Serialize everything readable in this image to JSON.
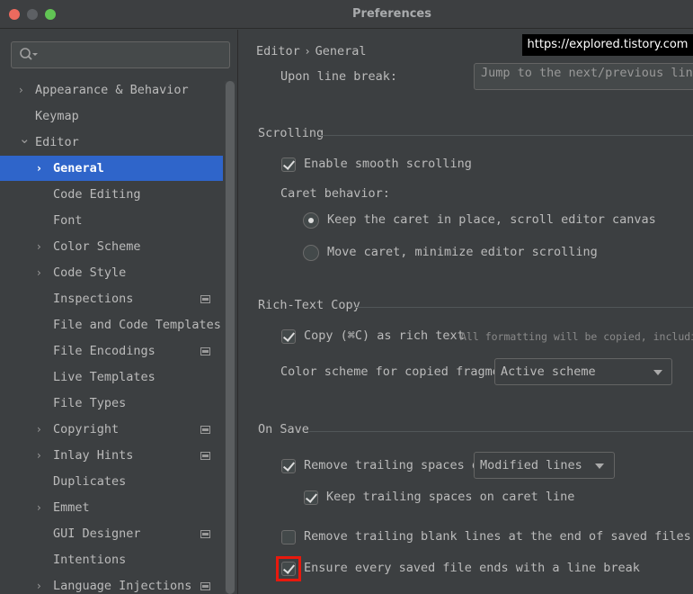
{
  "window": {
    "title": "Preferences"
  },
  "sidebar": {
    "search": {
      "placeholder": ""
    },
    "items": [
      {
        "label": "Appearance & Behavior",
        "expandable": true,
        "expanded": false,
        "level": 0,
        "tag": false
      },
      {
        "label": "Keymap",
        "expandable": false,
        "level": 0,
        "tag": false
      },
      {
        "label": "Editor",
        "expandable": true,
        "expanded": true,
        "level": 0,
        "tag": false
      },
      {
        "label": "General",
        "expandable": true,
        "expanded": false,
        "level": 1,
        "tag": false,
        "selected": true
      },
      {
        "label": "Code Editing",
        "expandable": false,
        "level": 1,
        "tag": false
      },
      {
        "label": "Font",
        "expandable": false,
        "level": 1,
        "tag": false
      },
      {
        "label": "Color Scheme",
        "expandable": true,
        "expanded": false,
        "level": 1,
        "tag": false
      },
      {
        "label": "Code Style",
        "expandable": true,
        "expanded": false,
        "level": 1,
        "tag": false
      },
      {
        "label": "Inspections",
        "expandable": false,
        "level": 1,
        "tag": true
      },
      {
        "label": "File and Code Templates",
        "expandable": false,
        "level": 1,
        "tag": false
      },
      {
        "label": "File Encodings",
        "expandable": false,
        "level": 1,
        "tag": true
      },
      {
        "label": "Live Templates",
        "expandable": false,
        "level": 1,
        "tag": false
      },
      {
        "label": "File Types",
        "expandable": false,
        "level": 1,
        "tag": false
      },
      {
        "label": "Copyright",
        "expandable": true,
        "expanded": false,
        "level": 1,
        "tag": true
      },
      {
        "label": "Inlay Hints",
        "expandable": true,
        "expanded": false,
        "level": 1,
        "tag": true
      },
      {
        "label": "Duplicates",
        "expandable": false,
        "level": 1,
        "tag": false
      },
      {
        "label": "Emmet",
        "expandable": true,
        "expanded": false,
        "level": 1,
        "tag": false
      },
      {
        "label": "GUI Designer",
        "expandable": false,
        "level": 1,
        "tag": true
      },
      {
        "label": "Intentions",
        "expandable": false,
        "level": 1,
        "tag": false
      },
      {
        "label": "Language Injections",
        "expandable": true,
        "expanded": false,
        "level": 1,
        "tag": true
      }
    ]
  },
  "breadcrumb": {
    "parent": "Editor",
    "separator": "›",
    "current": "General"
  },
  "watermark": "https://explored.tistory.com",
  "content": {
    "line_break": {
      "label": "Upon line break:",
      "value": "Jump to the next/previous line bou"
    },
    "scrolling": {
      "title": "Scrolling",
      "smooth": {
        "label": "Enable smooth scrolling",
        "checked": true
      },
      "caret_label": "Caret behavior:",
      "caret_options": [
        {
          "label": "Keep the caret in place, scroll editor canvas",
          "selected": true
        },
        {
          "label": "Move caret, minimize editor scrolling",
          "selected": false
        }
      ]
    },
    "rich_text": {
      "title": "Rich-Text Copy",
      "copy": {
        "label": "Copy (⌘C) as rich text",
        "checked": true,
        "hint": "All formatting will be copied, including font"
      },
      "scheme_label": "Color scheme for copied fragment:",
      "scheme_value": "Active scheme"
    },
    "on_save": {
      "title": "On Save",
      "trailing": {
        "label": "Remove trailing spaces on:",
        "checked": true,
        "value": "Modified lines"
      },
      "keep_caret": {
        "label": "Keep trailing spaces on caret line",
        "checked": true
      },
      "blank_lines": {
        "label": "Remove trailing blank lines at the end of saved files",
        "checked": false
      },
      "line_break": {
        "label": "Ensure every saved file ends with a line break",
        "checked": true
      }
    }
  },
  "colors": {
    "selection": "#2f65ca",
    "highlight": "#e8190d",
    "background": "#3c3f41"
  }
}
